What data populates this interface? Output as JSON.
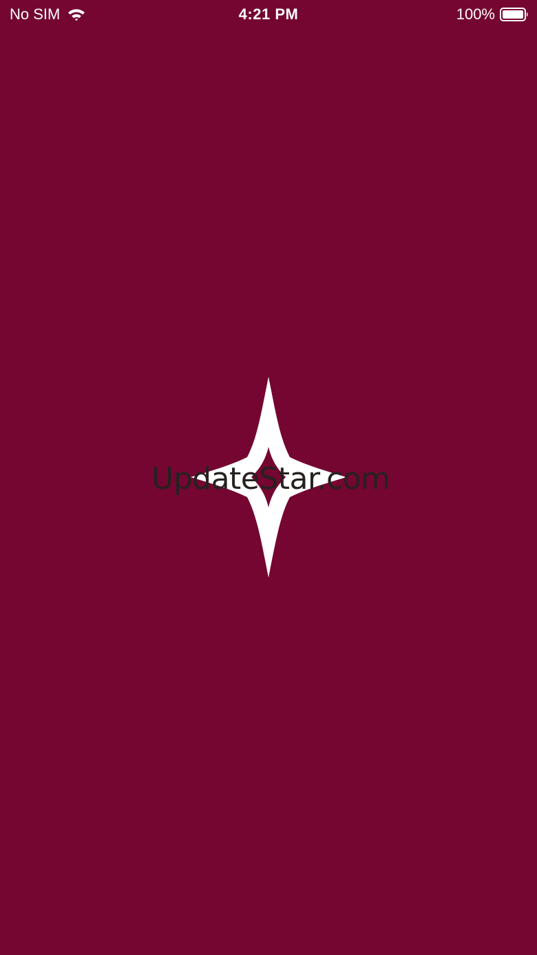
{
  "status_bar": {
    "carrier": "No SIM",
    "time": "4:21 PM",
    "battery_percent": "100%",
    "wifi_icon": "wifi-icon",
    "battery_icon": "battery-full-icon"
  },
  "splash": {
    "brand_name": "UpdateStar.com",
    "logo_icon": "four-point-star-icon"
  },
  "colors": {
    "background": "#740631",
    "status_text": "#ffffff",
    "logo": "#ffffff",
    "brand_text": "#26211f"
  }
}
